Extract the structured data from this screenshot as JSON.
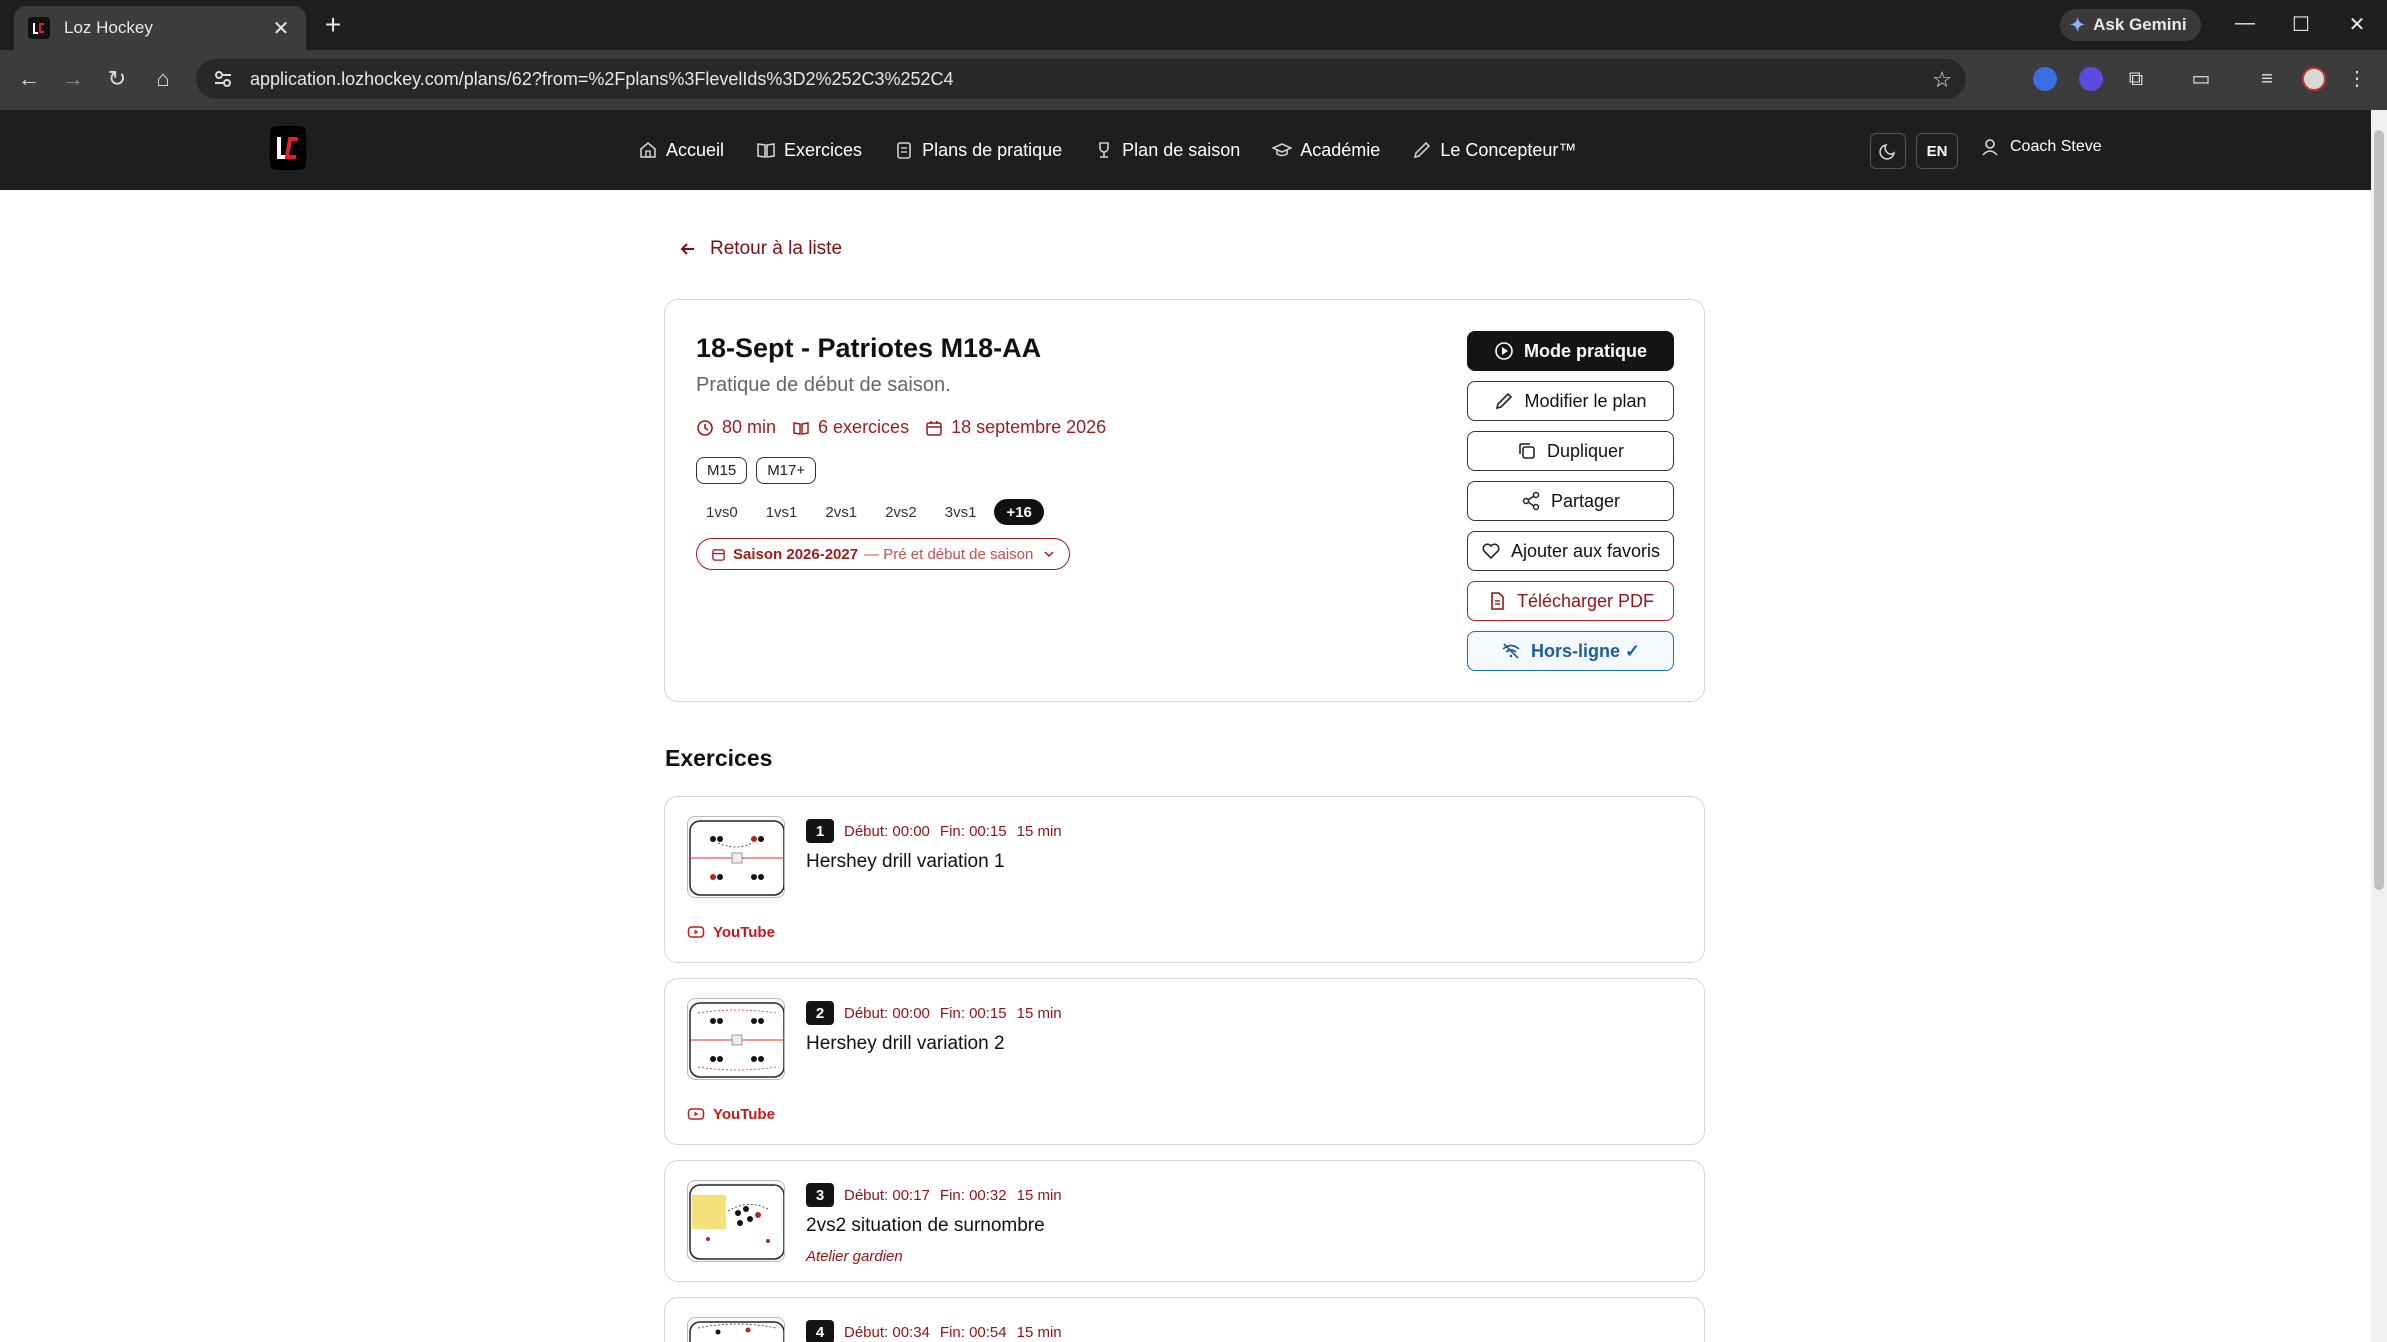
{
  "browser": {
    "tab_title": "Loz Hockey",
    "url": "application.lozhockey.com/plans/62?from=%2Fplans%3FlevelIds%3D2%252C3%252C4",
    "gemini_label": "Ask Gemini"
  },
  "nav": {
    "items": [
      {
        "label": "Accueil",
        "icon": "home-icon"
      },
      {
        "label": "Exercices",
        "icon": "book-icon"
      },
      {
        "label": "Plans de pratique",
        "icon": "clipboard-icon"
      },
      {
        "label": "Plan de saison",
        "icon": "trophy-icon"
      },
      {
        "label": "Académie",
        "icon": "graduation-cap-icon"
      },
      {
        "label": "Le Concepteur™",
        "icon": "pencil-icon"
      }
    ],
    "lang": "EN",
    "user": "Coach Steve"
  },
  "back_label": "Retour à la liste",
  "plan": {
    "title": "18-Sept - Patriotes M18-AA",
    "description": "Pratique de début de saison.",
    "duration": "80 min",
    "exercise_count": "6 exercices",
    "date": "18 septembre 2026",
    "levels": [
      "M15",
      "M17+"
    ],
    "tags": [
      "1vs0",
      "1vs1",
      "2vs1",
      "2vs2",
      "3vs1"
    ],
    "tags_more": "+16",
    "season": "Saison 2026-2027",
    "season_phase": "— Pré et début de saison"
  },
  "actions": {
    "practice_mode": "Mode pratique",
    "edit": "Modifier le plan",
    "duplicate": "Dupliquer",
    "share": "Partager",
    "favorite": "Ajouter aux favoris",
    "pdf": "Télécharger PDF",
    "offline": "Hors-ligne ✓"
  },
  "exercises_heading": "Exercices",
  "drills": [
    {
      "num": "1",
      "start": "Début: 00:00",
      "end": "Fin: 00:15",
      "duration": "15 min",
      "title": "Hershey drill variation 1",
      "link": "YouTube"
    },
    {
      "num": "2",
      "start": "Début: 00:00",
      "end": "Fin: 00:15",
      "duration": "15 min",
      "title": "Hershey drill variation 2",
      "link": "YouTube"
    },
    {
      "num": "3",
      "start": "Début: 00:17",
      "end": "Fin: 00:32",
      "duration": "15 min",
      "title": "2vs2 situation de surnombre",
      "subtitle": "Atelier gardien"
    },
    {
      "num": "4",
      "start": "Début: 00:34",
      "end": "Fin: 00:54",
      "duration": "15 min"
    }
  ],
  "colors": {
    "accent_red": "#9b1c1c",
    "dark": "#141414",
    "offline_blue": "#1a6fb0"
  }
}
